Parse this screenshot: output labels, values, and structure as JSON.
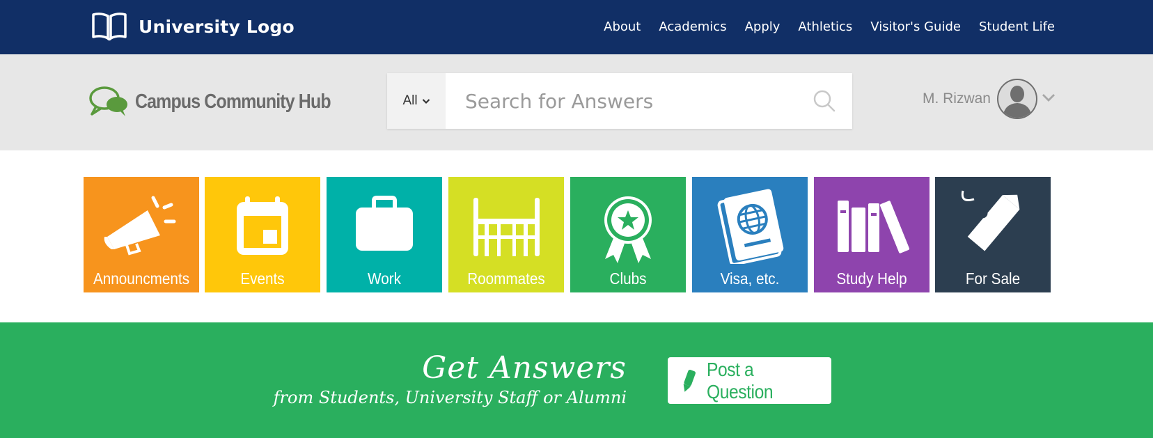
{
  "topbar": {
    "logo_text": "University Logo",
    "nav": [
      "About",
      "Academics",
      "Apply",
      "Athletics",
      "Visitor's Guide",
      "Student Life"
    ],
    "bg_color": "#112f66"
  },
  "header": {
    "hub_name": "Campus Community Hub",
    "search": {
      "scope": "All",
      "placeholder": "Search for Answers",
      "icon": "search-icon"
    },
    "user": {
      "name": "M. Rizwan",
      "avatar_icon": "user-silhouette-icon"
    }
  },
  "categories": [
    {
      "label": "Announcments",
      "color": "#f7941d",
      "icon": "megaphone-icon"
    },
    {
      "label": "Events",
      "color": "#ffc70a",
      "icon": "calendar-icon"
    },
    {
      "label": "Work",
      "color": "#00b1a8",
      "icon": "briefcase-icon"
    },
    {
      "label": "Roommates",
      "color": "#d5df24",
      "icon": "bunk-bed-icon"
    },
    {
      "label": "Clubs",
      "color": "#2aaf5e",
      "icon": "award-ribbon-icon"
    },
    {
      "label": "Visa, etc.",
      "color": "#2a7fbe",
      "icon": "passport-icon"
    },
    {
      "label": "Study Help",
      "color": "#8e44ad",
      "icon": "books-icon"
    },
    {
      "label": "For Sale",
      "color": "#2c3e50",
      "icon": "price-tag-icon"
    }
  ],
  "cta": {
    "title": "Get Answers",
    "subtitle": "from Students, University Staff or Alumni",
    "button_label": "Post a Question",
    "button_icon": "pencil-icon",
    "bg_color": "#2aaf5e"
  }
}
